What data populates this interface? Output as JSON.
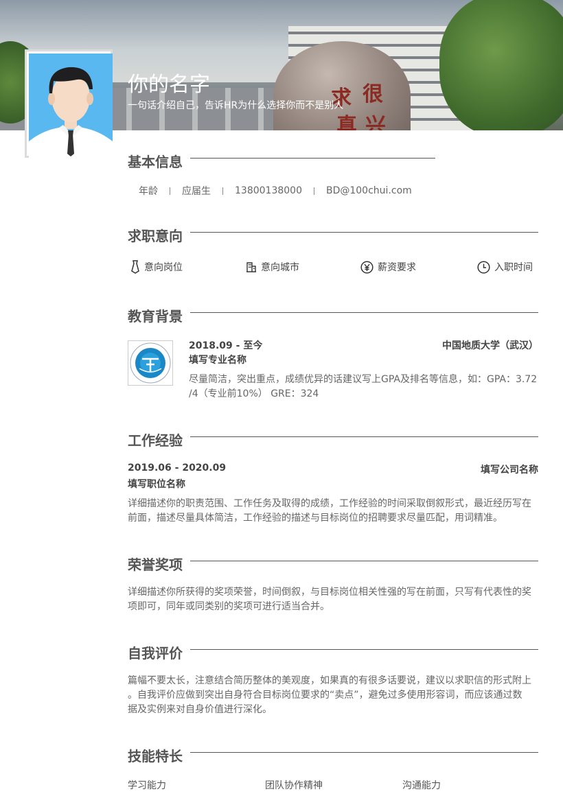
{
  "header": {
    "name": "你的名字",
    "tagline": "一句话介绍自己，告诉HR为什么选择你而不是别人"
  },
  "basic_info": {
    "title": "基本信息",
    "items": [
      "年龄",
      "应届生",
      "13800138000",
      "BD@100chui.com"
    ]
  },
  "intent": {
    "title": "求职意向",
    "items": [
      {
        "label": "意向岗位",
        "icon": "tie-icon"
      },
      {
        "label": "意向城市",
        "icon": "building-icon"
      },
      {
        "label": "薪资要求",
        "icon": "yen-icon"
      },
      {
        "label": "入职时间",
        "icon": "clock-icon"
      }
    ]
  },
  "education": {
    "title": "教育背景",
    "period": "2018.09 - 至今",
    "school": "中国地质大学（武汉）",
    "major": "填写专业名称",
    "desc_line1": "尽量简洁，突出重点，成绩优异的话建议写上GPA及排名等信息，如：GPA：3.72",
    "desc_line2": "/4（专业前10%）  GRE：324"
  },
  "work": {
    "title": "工作经验",
    "period": "2019.06 - 2020.09",
    "company": "填写公司名称",
    "position": "填写职位名称",
    "desc_line1": "详细描述你的职责范围、工作任务及取得的成绩，工作经验的时间采取倒叙形式，最近经历写在",
    "desc_line2": "前面，描述尽量具体简洁，工作经验的描述与目标岗位的招聘要求尽量匹配，用词精准。"
  },
  "honors": {
    "title": "荣誉奖项",
    "desc_line1": "详细描述你所获得的奖项荣誉，时间倒叙，与目标岗位相关性强的写在前面，只写有代表性的奖",
    "desc_line2": "项即可，同年或同类别的奖项可进行适当合并。"
  },
  "self_eval": {
    "title": "自我评价",
    "desc_line1": "篇幅不要太长，注意结合简历整体的美观度，如果真的有很多话要说，建议以求职信的形式附上",
    "desc_line2": "。自我评价应做到突出自身符合目标岗位要求的“卖点”，避免过多使用形容词，而应该通过数",
    "desc_line3": "据及实例来对自身价值进行深化。"
  },
  "skills": {
    "title": "技能特长",
    "items": [
      "学习能力",
      "团队协作精神",
      "沟通能力"
    ]
  },
  "colors": {
    "text": "#555555",
    "rule": "#555555",
    "photo_bg": "#5ab8f0"
  }
}
